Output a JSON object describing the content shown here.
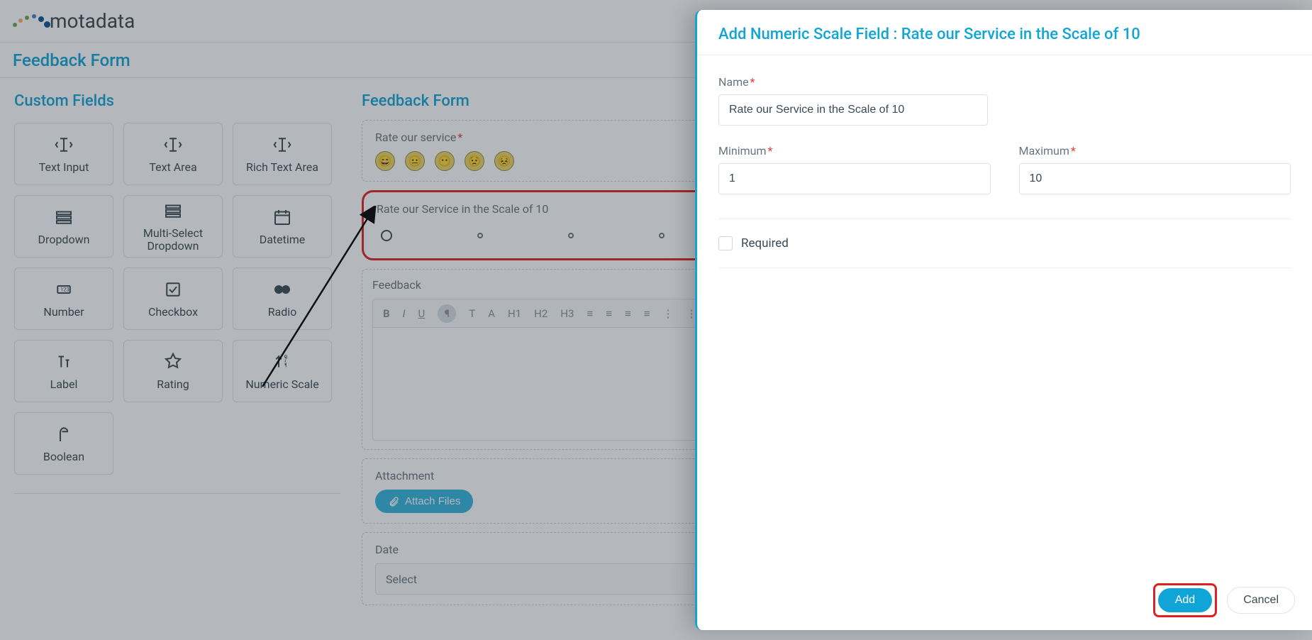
{
  "brand": "motadata",
  "page_title": "Feedback Form",
  "custom_fields": {
    "title": "Custom Fields",
    "items": [
      {
        "label": "Text Input"
      },
      {
        "label": "Text Area"
      },
      {
        "label": "Rich Text Area"
      },
      {
        "label": "Dropdown"
      },
      {
        "label": "Multi-Select Dropdown"
      },
      {
        "label": "Datetime"
      },
      {
        "label": "Number"
      },
      {
        "label": "Checkbox"
      },
      {
        "label": "Radio"
      },
      {
        "label": "Label"
      },
      {
        "label": "Rating"
      },
      {
        "label": "Numeric Scale"
      },
      {
        "label": "Boolean"
      }
    ]
  },
  "form_preview": {
    "title": "Feedback Form",
    "rate_service_label": "Rate our service",
    "emojis": [
      "😄",
      "😐",
      "😶",
      "😟",
      "😣"
    ],
    "scale_label": "Rate our Service in the Scale of 10",
    "feedback_label": "Feedback",
    "rte_buttons": [
      "B",
      "I",
      "U",
      "¶",
      "T",
      "A",
      "H1",
      "H2",
      "H3",
      "≡",
      "≡",
      "≡",
      "≡",
      "⋮",
      "⋮"
    ],
    "attachment_label": "Attachment",
    "attach_button": "Attach Files",
    "date_label": "Date",
    "date_placeholder": "Select"
  },
  "panel": {
    "title": "Add Numeric Scale Field : Rate our Service in the Scale of 10",
    "name_label": "Name",
    "name_value": "Rate our Service in the Scale of 10",
    "minimum_label": "Minimum",
    "minimum_value": "1",
    "maximum_label": "Maximum",
    "maximum_value": "10",
    "required_label": "Required",
    "add_button": "Add",
    "cancel_button": "Cancel"
  }
}
